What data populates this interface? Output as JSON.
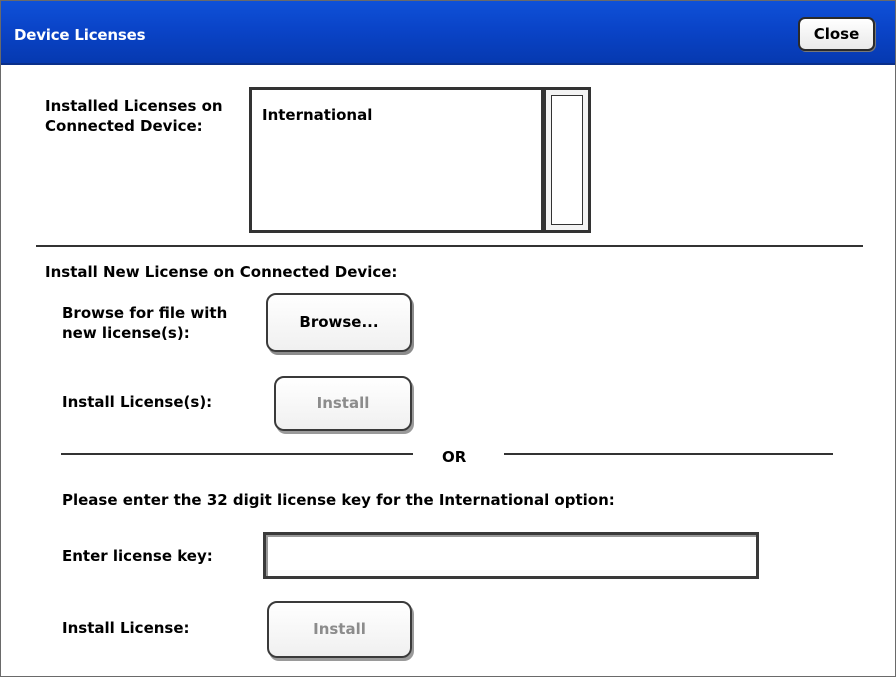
{
  "window": {
    "title": "Device Licenses",
    "close_label": "Close"
  },
  "installed": {
    "label": "Installed Licenses on Connected Device:",
    "items": [
      "International"
    ]
  },
  "install_new": {
    "heading": "Install New License on Connected Device:",
    "browse_label": "Browse for file with new license(s):",
    "browse_button": "Browse...",
    "install_files_label": "Install License(s):",
    "install_files_button": "Install",
    "or_text": "OR"
  },
  "license_key": {
    "instruction": "Please enter the 32 digit license key for the International option:",
    "label": "Enter license key:",
    "value": "",
    "placeholder": "",
    "install_label": "Install License:",
    "install_button": "Install"
  }
}
